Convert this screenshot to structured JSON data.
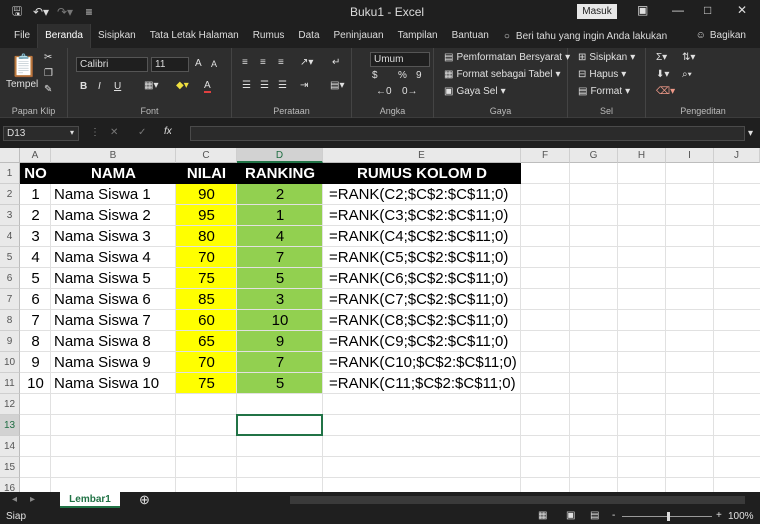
{
  "titlebar": {
    "title": "Buku1  -  Excel",
    "signin_label": "Masuk",
    "icons": [
      "save-icon",
      "undo-icon",
      "redo-icon",
      "customize-icon"
    ]
  },
  "tabs": [
    "File",
    "Beranda",
    "Sisipkan",
    "Tata Letak Halaman",
    "Rumus",
    "Data",
    "Peninjauan",
    "Tampilan",
    "Bantuan"
  ],
  "active_tab": "Beranda",
  "tell_me": "Beri tahu yang ingin Anda lakukan",
  "share_label": "Bagikan",
  "ribbon": {
    "paste_label": "Tempel",
    "clipboard_label": "Papan Klip",
    "font_name": "Calibri",
    "font_size": "11",
    "bold": "B",
    "italic": "I",
    "underline": "U",
    "font_label": "Font",
    "alignment_label": "Perataan",
    "number_format": "Umum",
    "number_label": "Angka",
    "cond_format": "Pemformatan Bersyarat",
    "format_table": "Format sebagai Tabel",
    "cell_style": "Gaya Sel",
    "styles_label": "Gaya",
    "insert": "Sisipkan",
    "delete": "Hapus",
    "format": "Format",
    "cells_label": "Sel",
    "editing_label": "Pengeditan",
    "size_up": "A",
    "size_down": "A",
    "font_color_glyph": "A",
    "currency": "$",
    "percent": "%",
    "comma": "9"
  },
  "formula_bar": {
    "name_box": "D13",
    "fx": "fx",
    "cancel": "✕",
    "enter": "✓",
    "value": ""
  },
  "columns": [
    "A",
    "B",
    "C",
    "D",
    "E",
    "F",
    "G",
    "H",
    "I",
    "J"
  ],
  "selected_column": "D",
  "rows": [
    "1",
    "2",
    "3",
    "4",
    "5",
    "6",
    "7",
    "8",
    "9",
    "10",
    "11",
    "12",
    "13",
    "14",
    "15",
    "16"
  ],
  "selected_row": "13",
  "headers": {
    "no": "NO",
    "nama": "NAMA",
    "nilai": "NILAI",
    "ranking": "RANKING",
    "rumus": "RUMUS KOLOM D"
  },
  "table": [
    {
      "no": "1",
      "nama": "Nama Siswa 1",
      "nilai": "90",
      "ranking": "2",
      "rumus": "=RANK(C2;$C$2:$C$11;0)"
    },
    {
      "no": "2",
      "nama": "Nama Siswa 2",
      "nilai": "95",
      "ranking": "1",
      "rumus": "=RANK(C3;$C$2:$C$11;0)"
    },
    {
      "no": "3",
      "nama": "Nama Siswa 3",
      "nilai": "80",
      "ranking": "4",
      "rumus": "=RANK(C4;$C$2:$C$11;0)"
    },
    {
      "no": "4",
      "nama": "Nama Siswa 4",
      "nilai": "70",
      "ranking": "7",
      "rumus": "=RANK(C5;$C$2:$C$11;0)"
    },
    {
      "no": "5",
      "nama": "Nama Siswa 5",
      "nilai": "75",
      "ranking": "5",
      "rumus": "=RANK(C6;$C$2:$C$11;0)"
    },
    {
      "no": "6",
      "nama": "Nama Siswa 6",
      "nilai": "85",
      "ranking": "3",
      "rumus": "=RANK(C7;$C$2:$C$11;0)"
    },
    {
      "no": "7",
      "nama": "Nama Siswa 7",
      "nilai": "60",
      "ranking": "10",
      "rumus": "=RANK(C8;$C$2:$C$11;0)"
    },
    {
      "no": "8",
      "nama": "Nama Siswa 8",
      "nilai": "65",
      "ranking": "9",
      "rumus": "=RANK(C9;$C$2:$C$11;0)"
    },
    {
      "no": "9",
      "nama": "Nama Siswa 9",
      "nilai": "70",
      "ranking": "7",
      "rumus": "=RANK(C10;$C$2:$C$11;0)"
    },
    {
      "no": "10",
      "nama": "Nama Siswa 10",
      "nilai": "75",
      "ranking": "5",
      "rumus": "=RANK(C11;$C$2:$C$11;0)"
    }
  ],
  "sheet_tab": "Lembar1",
  "status": {
    "ready": "Siap",
    "zoom": "100%",
    "minus": "-",
    "plus": "+"
  },
  "colors": {
    "accent": "#217346",
    "nilai_fill": "#ffff00",
    "ranking_fill": "#92d050",
    "header_fill": "#000000"
  }
}
